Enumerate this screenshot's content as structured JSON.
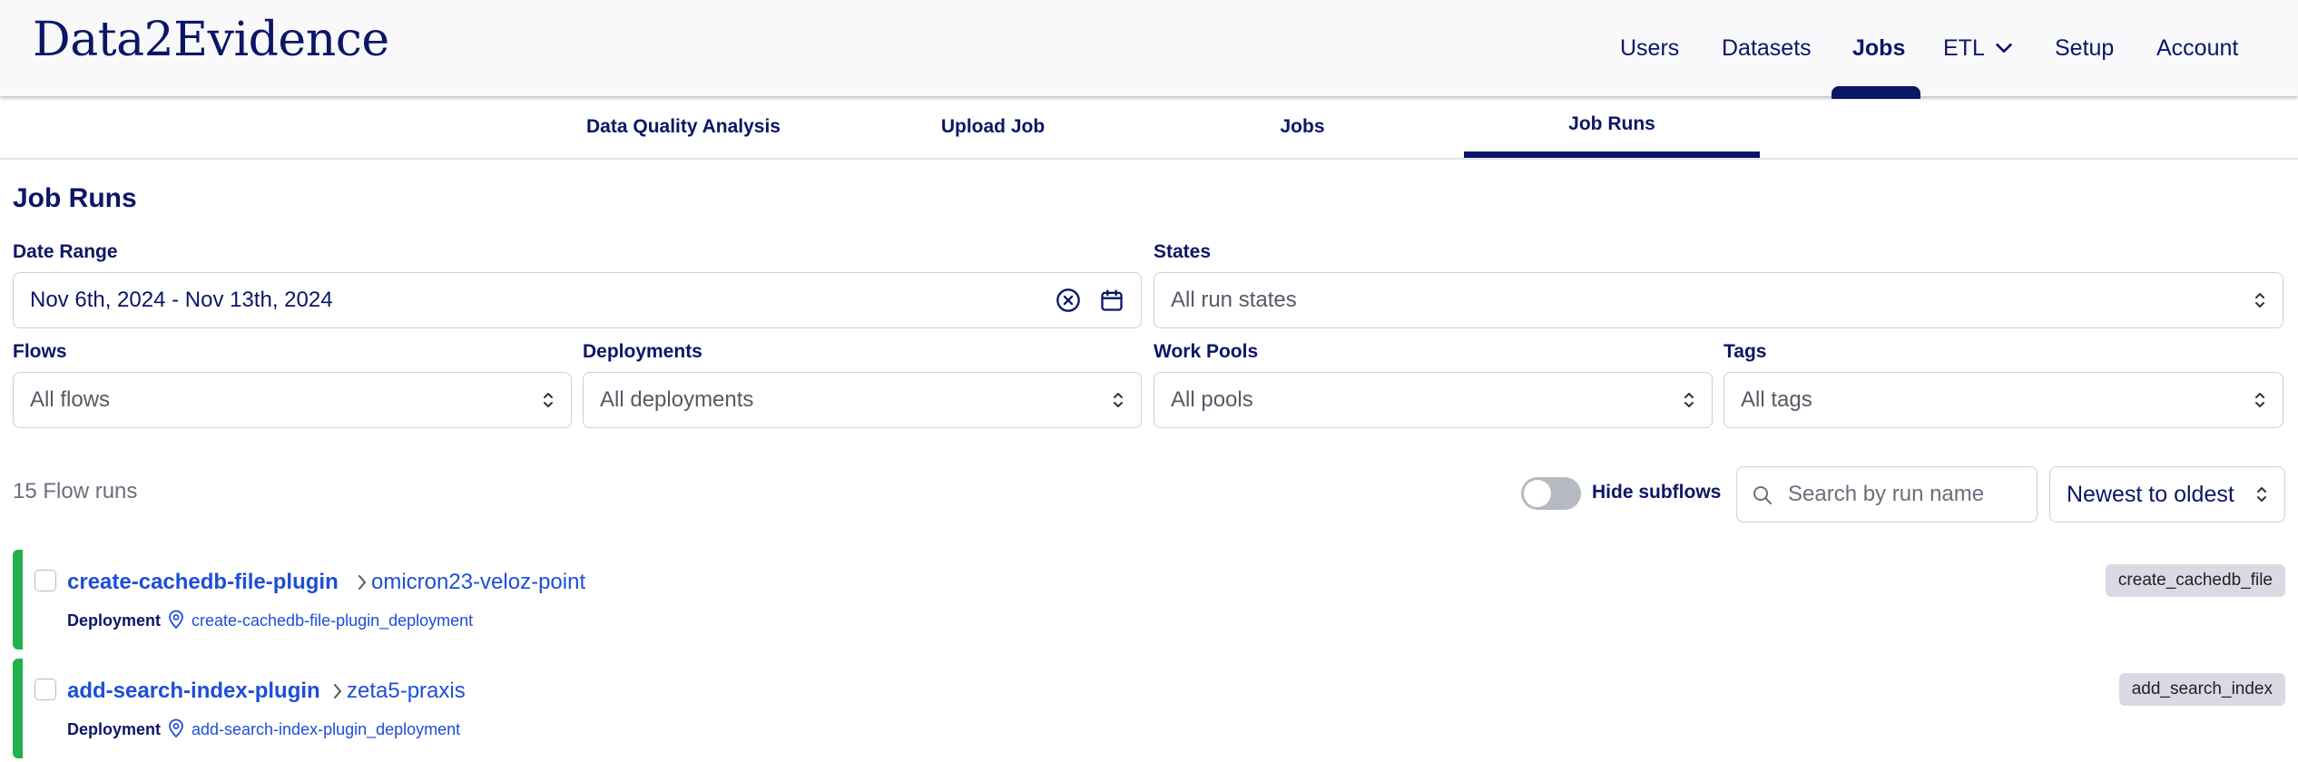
{
  "app": {
    "logo": "Data2Evidence"
  },
  "topnav": {
    "users": "Users",
    "datasets": "Datasets",
    "jobs": "Jobs",
    "etl": "ETL",
    "setup": "Setup",
    "account": "Account"
  },
  "subtabs": {
    "dqa": "Data Quality Analysis",
    "upload": "Upload Job",
    "jobs": "Jobs",
    "job_runs": "Job Runs"
  },
  "page": {
    "title": "Job Runs"
  },
  "filters": {
    "date_range_label": "Date Range",
    "date_range_value": "Nov 6th, 2024 - Nov 13th, 2024",
    "states_label": "States",
    "states_value": "All run states",
    "flows_label": "Flows",
    "flows_value": "All flows",
    "deployments_label": "Deployments",
    "deployments_value": "All deployments",
    "work_pools_label": "Work Pools",
    "work_pools_value": "All pools",
    "tags_label": "Tags",
    "tags_value": "All tags"
  },
  "list_controls": {
    "count": "15 Flow runs",
    "hide_subflows": "Hide subflows",
    "hide_subflows_on": false,
    "search_placeholder": "Search by run name",
    "sort_value": "Newest to oldest"
  },
  "runs": [
    {
      "flow": "create-cachedb-file-plugin",
      "run_name": "omicron23-veloz-point",
      "deployment_label": "Deployment",
      "deployment": "create-cachedb-file-plugin_deployment",
      "tag": "create_cachedb_file",
      "state_color": "#22b14c"
    },
    {
      "flow": "add-search-index-plugin",
      "run_name": "zeta5-praxis",
      "deployment_label": "Deployment",
      "deployment": "add-search-index-plugin_deployment",
      "tag": "add_search_index",
      "state_color": "#22b14c"
    }
  ],
  "colors": {
    "brand": "#0b1667",
    "link": "#1d4ed8",
    "completed": "#22b14c"
  }
}
